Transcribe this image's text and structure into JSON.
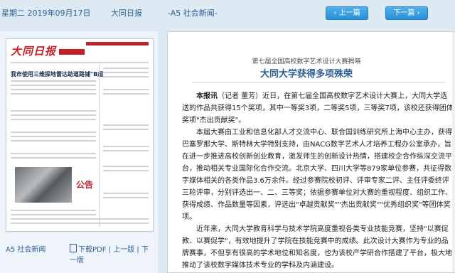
{
  "topbar": {
    "date": "星期二 2019年09月17日",
    "paper": "大同日报",
    "section": "-A5 社会新闻-",
    "prev_label": "上一篇",
    "next_label": "下一篇"
  },
  "thumbnail": {
    "logo": "大同日报",
    "headline": "我市使用三维探地雷达助道路铺\"B超\"",
    "ad_label": "公告"
  },
  "left_footer": {
    "section": "A5 社会新闻",
    "pdf_label": "下载PDF",
    "prev": "上一版",
    "next": "下一版"
  },
  "article": {
    "kicker": "第七届全国高校数字艺术设计大赛揭晓",
    "title": "大同大学获得多项殊荣",
    "lead_bold": "本报讯",
    "paragraphs": [
      "（记者 董芳）近日，在第七届全国高校数字艺术设计大赛上，大同大学选送的作品共获得15个奖项，其中一等奖3项，二等奖5项，三等奖7项，该校还获得团体奖项\"杰出贡献奖\"。",
      "本届大赛由工业和信息化部人才交流中心、联合国训练研究所上海中心主办，获得巴塞罗那大学、斯特林大学特别支持，由NACG数字艺术人才培养工程办公室承办，旨在进一步推进高校创新创业教育，激发师生的创新设计热情，搭建校企合作纵深交流平台，推动相关专业国际化合作交流。北京大学、四川大学等879家单位参赛，共征得数",
      "字媒体相关的各类作品3.6万余件。经过参赛院校初评、评审专家二评、主任评委终评三轮评审，分别评选出一、二、三等奖；依据参赛单位对大赛的重视程度、组织工作、获得成绩、作品数量等因素，评选出\"卓越贡献奖\"\"杰出贡献奖\"\"优秀组织奖\"等团体奖项。",
      "近年来，大同大学教育科学与技术学院高度重视各类专业技能竞赛，坚持\"以赛促教、以赛促学\"，有效地提升了学院在技能竞赛中的成绩。此次设计大赛作为专业的品牌赛事，不但享有很高的学术地位和知名度，也为该校产学研合作搭建了平台，极大地推动了该校数字媒体技术专业的学科及内涵建设。"
    ]
  }
}
